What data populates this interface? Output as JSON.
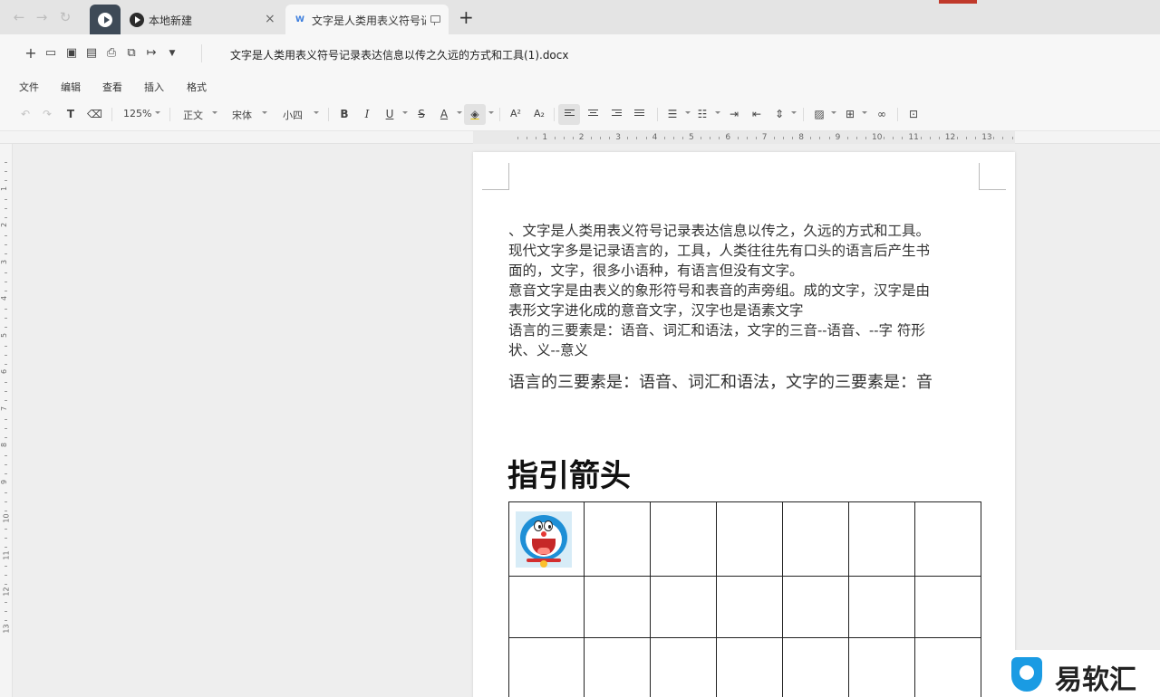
{
  "tabs": {
    "local_title": "本地新建",
    "doc_title": "文字是人类用表义符号记",
    "close_glyph": "×",
    "new_tab_glyph": "+"
  },
  "document": {
    "filename": "文字是人类用表义符号记录表达信息以传之久远的方式和工具(1).docx"
  },
  "menu": [
    "文件",
    "编辑",
    "查看",
    "插入",
    "格式"
  ],
  "toolbar": {
    "zoom": "125%",
    "style": "正文",
    "font": "宋体",
    "size": "小四",
    "bold": "B",
    "italic": "I",
    "underline": "U",
    "strike": "S",
    "font_color": "A",
    "superscript": "A²",
    "subscript": "A₂",
    "link_glyph": "∞"
  },
  "ruler": {
    "numbers": [
      "1",
      "2",
      "3",
      "4",
      "5",
      "6",
      "7",
      "8",
      "9",
      "10",
      "11",
      "12",
      "13"
    ],
    "v_numbers": [
      "1",
      "2",
      "3",
      "4",
      "5",
      "6",
      "7",
      "8",
      "9",
      "10",
      "11",
      "12",
      "13"
    ]
  },
  "content": {
    "paragraph_lines": [
      "、文字是人类用表义符号记录表达信息以传之，久远的方式和工具。",
      "现代文字多是记录语言的，工具，人类往往先有口头的语言后产生书",
      "面的，文字，很多小语种，有语言但没有文字。",
      "意音文字是由表义的象形符号和表音的声旁组。成的文字，汉字是由",
      "表形文字进化成的意音文字，汉字也是语素文字",
      "语言的三要素是：语音、词汇和语法，文字的三音--语音、--字  符形",
      "状、义--意义"
    ],
    "large_line": "语言的三要素是：语音、词汇和语法，文字的三要素是：音",
    "heading": "指引箭头"
  },
  "table": {
    "rows": 3,
    "cols": 7
  },
  "watermark": {
    "text": "易软汇"
  },
  "colors": {
    "home_tab": "#3e4a57",
    "accent_blue": "#1a9be3",
    "page_bg": "#ffffff",
    "workspace_bg": "#eeeeee"
  },
  "icons": {
    "back": "arrow-left-icon",
    "forward": "arrow-right-icon",
    "reload": "reload-icon",
    "new": "plus-icon",
    "open": "folder-icon",
    "save": "save-icon",
    "save_as": "save-as-icon",
    "print": "printer-icon",
    "export": "export-icon",
    "share": "share-icon",
    "more": "caret-down-icon"
  }
}
